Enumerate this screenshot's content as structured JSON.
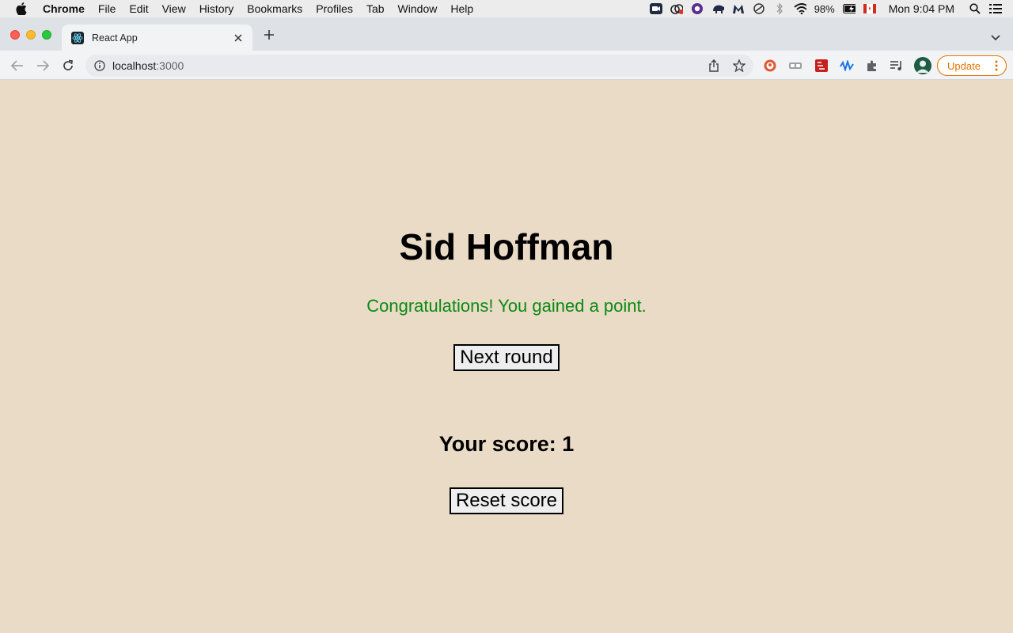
{
  "menubar": {
    "items": [
      "Chrome",
      "File",
      "Edit",
      "View",
      "History",
      "Bookmarks",
      "Profiles",
      "Tab",
      "Window",
      "Help"
    ],
    "battery": "98%",
    "clock": "Mon 9:04 PM"
  },
  "browser": {
    "tab_title": "React App",
    "url_host": "localhost",
    "url_port": ":3000",
    "update_label": "Update",
    "accent_color": "#e37400"
  },
  "page": {
    "title": "Sid Hoffman",
    "message": "Congratulations! You gained a point.",
    "message_color": "#0a8a14",
    "next_button": "Next round",
    "score_text": "Your score: 1",
    "reset_button": "Reset score",
    "background": "#eadbc6"
  }
}
